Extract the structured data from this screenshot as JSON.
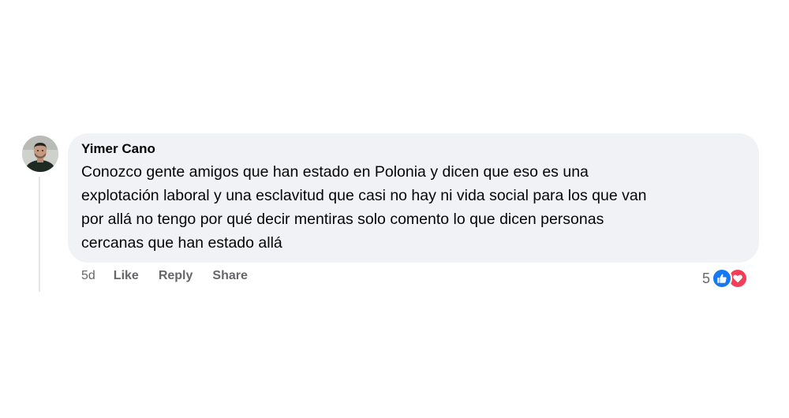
{
  "comment": {
    "author": "Yimer Cano",
    "text": "Conozco gente amigos que han estado en Polonia y dicen que eso es una\nexplotación laboral y una esclavitud que casi no hay ni vida social para los que van\npor allá no tengo por qué decir mentiras solo comento lo que dicen personas\ncercanas que han estado allá",
    "timestamp": "5d",
    "actions": {
      "like": "Like",
      "reply": "Reply",
      "share": "Share"
    },
    "reactions": {
      "count": "5",
      "icons": [
        "like-icon",
        "love-icon"
      ]
    }
  },
  "colors": {
    "bubble_background": "#f0f2f5",
    "like_blue": "#1877f2",
    "love_red": "#f33e58",
    "secondary_text": "#65676b"
  }
}
